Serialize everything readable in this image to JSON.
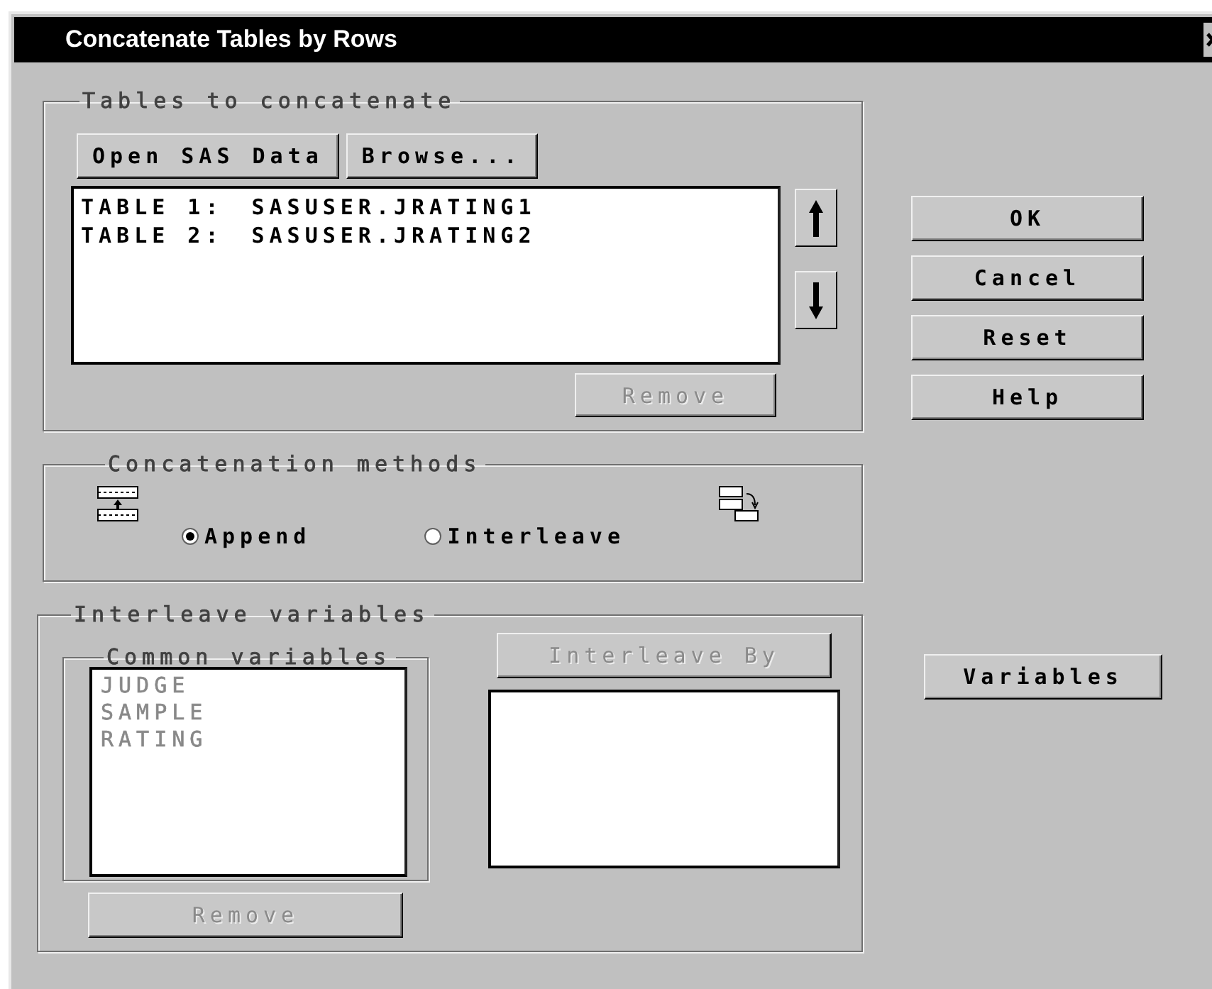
{
  "window": {
    "title": "Concatenate Tables by Rows"
  },
  "tables_group": {
    "label": "Tables to concatenate",
    "buttons": [
      "Open SAS Data",
      "Browse..."
    ],
    "rows": [
      {
        "label": "TABLE 1:",
        "value": "SASUSER.JRATING1"
      },
      {
        "label": "TABLE 2:",
        "value": "SASUSER.JRATING2"
      }
    ],
    "remove": {
      "label": "Remove",
      "disabled": true
    }
  },
  "methods_group": {
    "label": "Concatenation methods",
    "options": [
      {
        "label": "Append",
        "selected": true
      },
      {
        "label": "Interleave",
        "selected": false
      }
    ]
  },
  "interleave_group": {
    "label": "Interleave variables",
    "common": {
      "label": "Common variables",
      "disabled": true,
      "items": [
        "JUDGE",
        "SAMPLE",
        "RATING"
      ]
    },
    "interleave_by": {
      "label": "Interleave By",
      "disabled": true
    },
    "remove": {
      "label": "Remove",
      "disabled": true
    }
  },
  "actions": [
    "OK",
    "Cancel",
    "Reset",
    "Help"
  ],
  "variables_button": "Variables"
}
